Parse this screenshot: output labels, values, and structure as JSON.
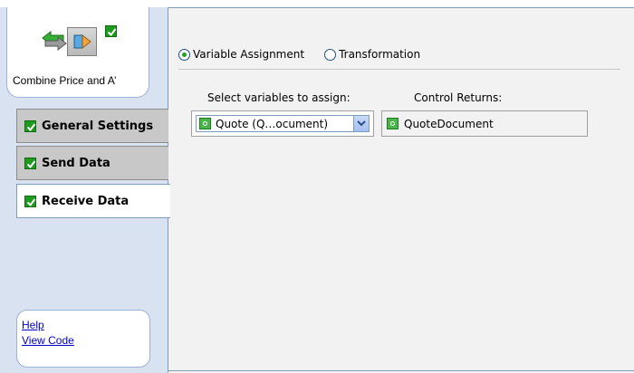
{
  "activity": {
    "name": "Combine Price and A’",
    "status_icon": "check-icon",
    "icons": [
      "swap-arrows-icon",
      "transform-ab-icon"
    ]
  },
  "tabs": [
    {
      "label": "General Settings",
      "checked": true,
      "active": false
    },
    {
      "label": "Send Data",
      "checked": true,
      "active": false
    },
    {
      "label": "Receive Data",
      "checked": true,
      "active": true
    }
  ],
  "help": {
    "help_link": "Help",
    "view_code_link": "View Code"
  },
  "mode": {
    "options": [
      "Variable Assignment",
      "Transformation"
    ],
    "selected": "Variable Assignment"
  },
  "assign": {
    "select_header": "Select variables to assign:",
    "returns_header": "Control Returns:",
    "selected_variable": "Quote (Q…ocument)",
    "control_return": "QuoteDocument"
  },
  "colors": {
    "accent_green": "#1e9a1e",
    "link_blue": "#0000cc",
    "border_blue": "#7f9db9"
  }
}
